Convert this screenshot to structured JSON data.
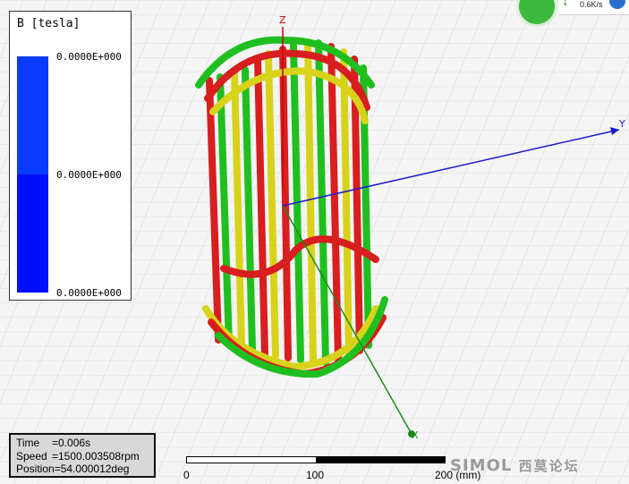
{
  "legend": {
    "title": "B [tesla]",
    "values": [
      "0.0000E+000",
      "0.0000E+000",
      "0.0000E+000"
    ],
    "colors": {
      "top": "#0a3cff",
      "mid": "#0b55f0",
      "bottom": "#0010ff"
    }
  },
  "axes": {
    "z_label": "Z",
    "y_label": "Y",
    "x_label": "X"
  },
  "info": {
    "time_key": "Time",
    "time_val": "=0.006s",
    "speed_key": "Speed",
    "speed_val": "=1500.003508rpm",
    "position_key": "Position",
    "position_val": "=54.000012deg"
  },
  "scale": {
    "labels": [
      "0",
      "100",
      "200 (mm)"
    ]
  },
  "brand": {
    "text": "SIMOL",
    "cn": "西莫论坛"
  },
  "network": {
    "rate": "0.6K/s",
    "arrow": "↓"
  },
  "coil_colors": {
    "red": "#d81e1e",
    "green": "#1fbf1f",
    "yellow": "#d8d21a"
  }
}
